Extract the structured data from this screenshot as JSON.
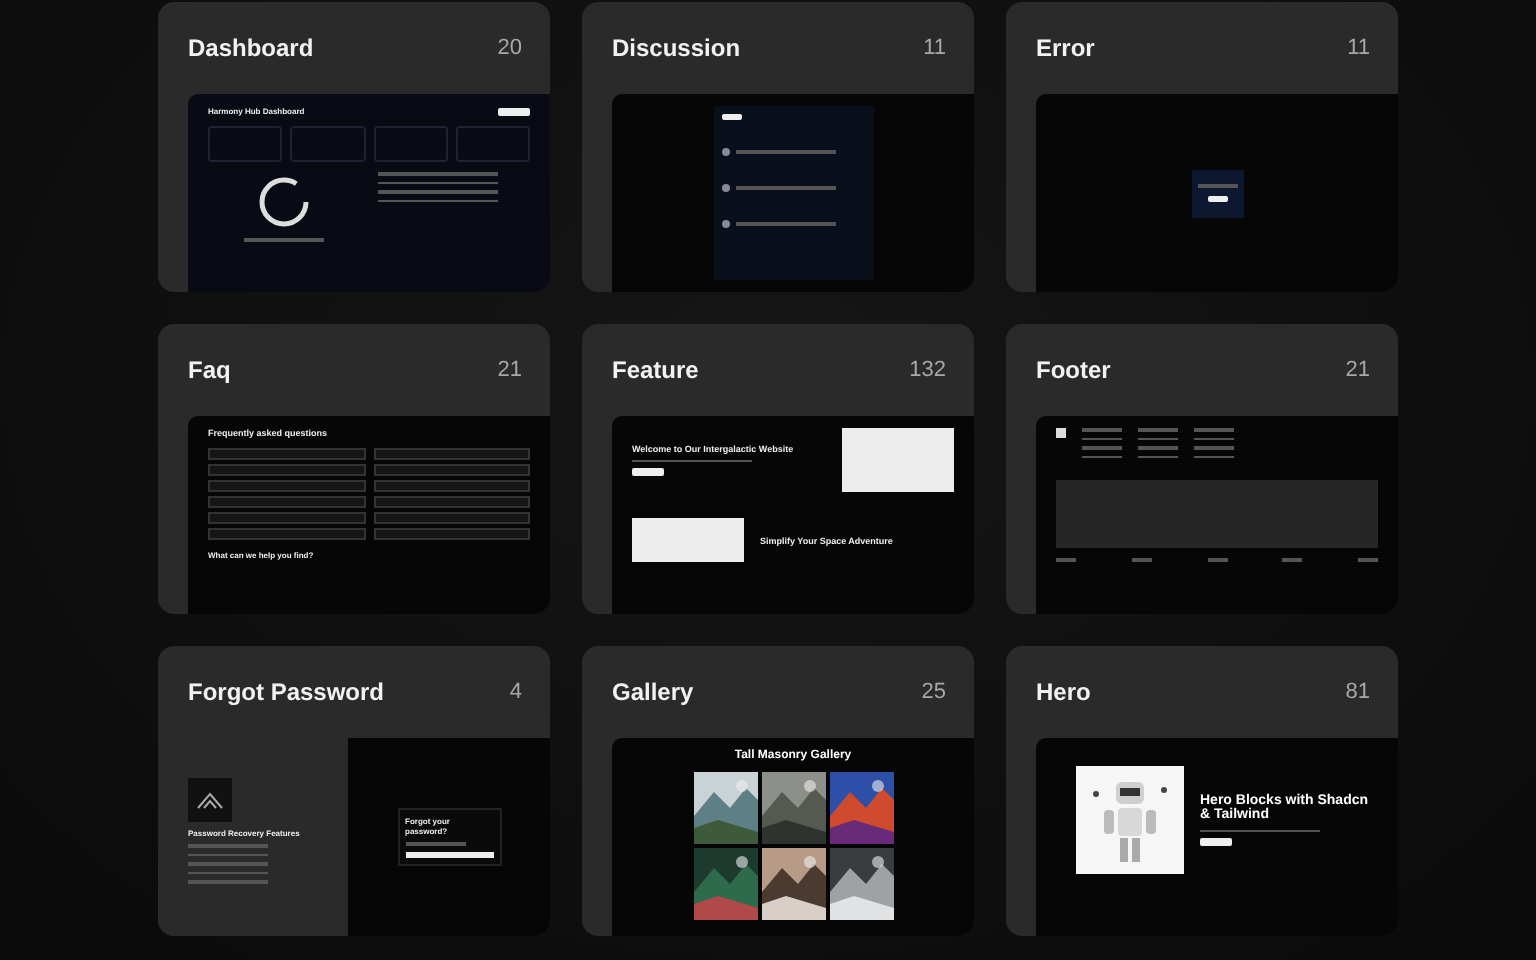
{
  "cards": [
    {
      "title": "Dashboard",
      "count": "20",
      "preview": {
        "kind": "dashboard",
        "heading": "Harmony Hub Dashboard"
      }
    },
    {
      "title": "Discussion",
      "count": "11",
      "preview": {
        "kind": "discussion"
      }
    },
    {
      "title": "Error",
      "count": "11",
      "preview": {
        "kind": "error"
      }
    },
    {
      "title": "Faq",
      "count": "21",
      "preview": {
        "kind": "faq",
        "heading": "Frequently asked questions",
        "subheading": "What can we help you find?"
      }
    },
    {
      "title": "Feature",
      "count": "132",
      "preview": {
        "kind": "feature",
        "heading": "Welcome to Our Intergalactic Website",
        "subheading": "Simplify Your Space Adventure"
      }
    },
    {
      "title": "Footer",
      "count": "21",
      "preview": {
        "kind": "footer"
      }
    },
    {
      "title": "Forgot Password",
      "count": "4",
      "preview": {
        "kind": "forgot",
        "heading": "Password Recovery Features",
        "subheading": "Forgot your password?"
      }
    },
    {
      "title": "Gallery",
      "count": "25",
      "preview": {
        "kind": "gallery",
        "heading": "Tall Masonry Gallery"
      }
    },
    {
      "title": "Hero",
      "count": "81",
      "preview": {
        "kind": "hero",
        "heading": "Hero Blocks with Shadcn & Tailwind"
      }
    }
  ]
}
